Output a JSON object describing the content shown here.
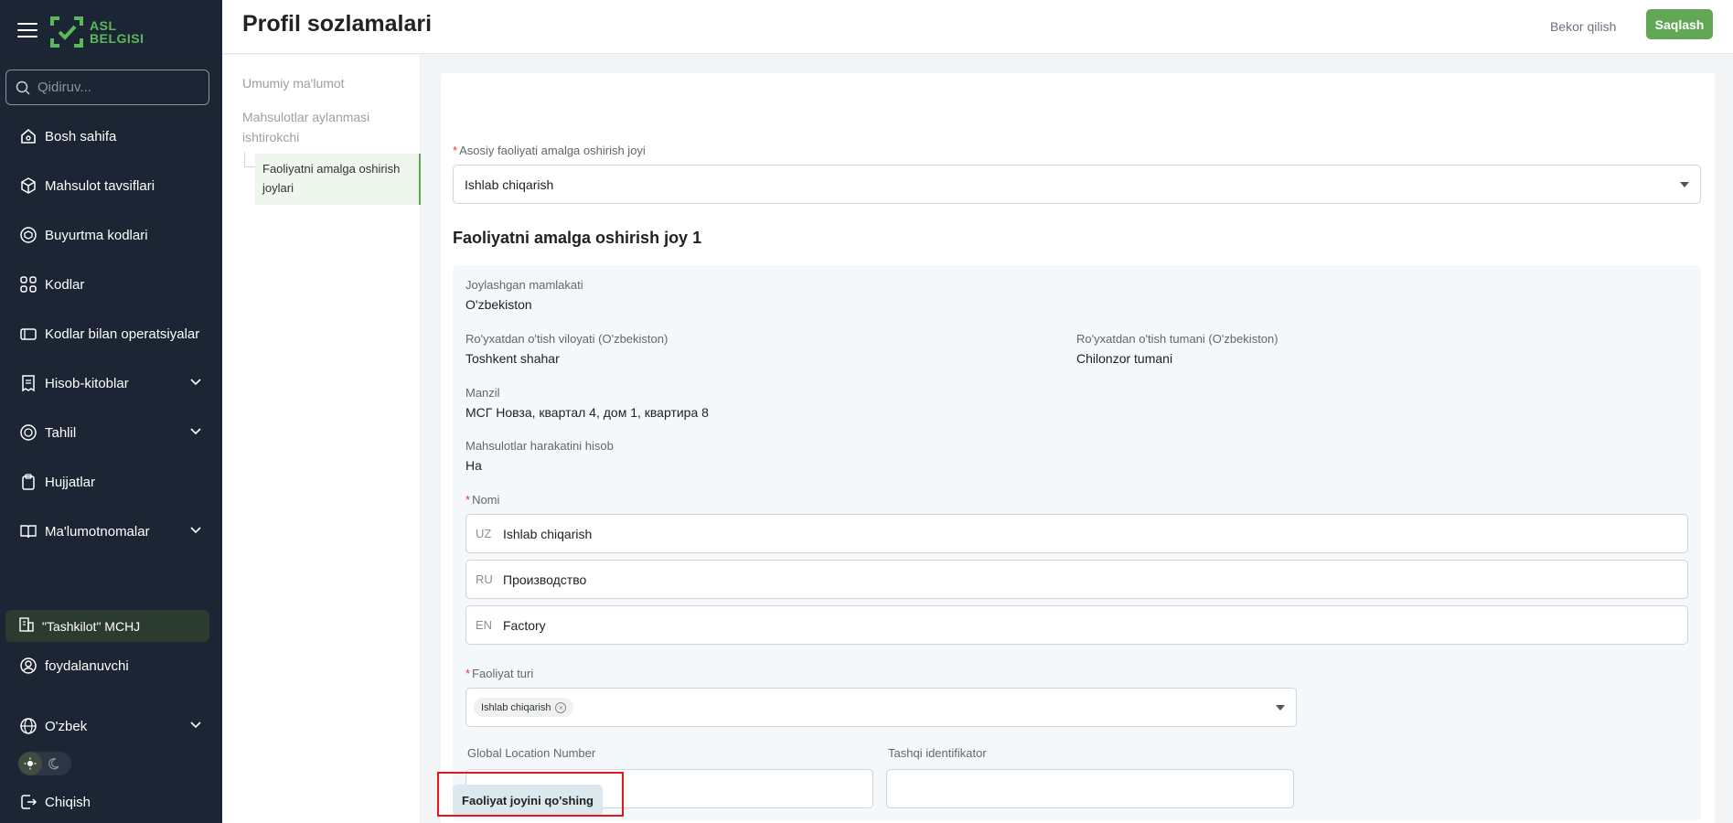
{
  "sidebar": {
    "logo_text_line1": "ASL",
    "logo_text_line2": "BELGISI",
    "search_placeholder": "Qidiruv...",
    "items": [
      {
        "label": "Bosh sahifa",
        "icon": "home-icon"
      },
      {
        "label": "Mahsulot tavsiflari",
        "icon": "box-icon"
      },
      {
        "label": "Buyurtma kodlari",
        "icon": "package-icon"
      },
      {
        "label": "Kodlar",
        "icon": "qr-icon"
      },
      {
        "label": "Kodlar bilan operatsiyalar",
        "icon": "tag-icon"
      },
      {
        "label": "Hisob-kitoblar",
        "icon": "receipt-icon"
      },
      {
        "label": "Tahlil",
        "icon": "chart-icon"
      },
      {
        "label": "Hujjatlar",
        "icon": "clipboard-icon"
      },
      {
        "label": "Ma'lumotnomalar",
        "icon": "book-icon"
      }
    ],
    "organization": "\"Tashkilot\" MCHJ",
    "user": "foydalanuvchi",
    "language": "O'zbek",
    "logout": "Chiqish"
  },
  "header": {
    "title": "Profil sozlamalari",
    "cancel_label": "Bekor qilish",
    "save_label": "Saqlash"
  },
  "subnav": {
    "items": [
      "Umumiy ma'lumot",
      "Mahsulotlar aylanmasi ishtirokchi",
      "Faoliyatni amalga oshirish joylari"
    ]
  },
  "form": {
    "main_place_label": "Asosiy faoliyati amalga oshirish joyi",
    "main_place_value": "Ishlab chiqarish",
    "section_title": "Faoliyatni amalga oshirish joy 1",
    "country_label": "Joylashgan mamlakati",
    "country_value": "O'zbekiston",
    "region_label": "Ro'yxatdan o'tish viloyati (O'zbekiston)",
    "region_value": "Toshkent shahar",
    "district_label": "Ro'yxatdan o'tish tumani (O'zbekiston)",
    "district_value": "Chilonzor tumani",
    "address_label": "Manzil",
    "address_value": "МСГ Новза, квартал 4, дом 1, квартира 8",
    "tracking_label": "Mahsulotlar harakatini hisob",
    "tracking_value": "На",
    "name_label": "Nomi",
    "names": [
      {
        "lang": "UZ",
        "value": "Ishlab chiqarish"
      },
      {
        "lang": "RU",
        "value": "Производство"
      },
      {
        "lang": "EN",
        "value": "Factory"
      }
    ],
    "activity_type_label": "Faoliyat turi",
    "activity_type_tag": "Ishlab chiqarish",
    "gln_label": "Global Location Number",
    "gln_value": "",
    "external_id_label": "Tashqi identifikator",
    "external_id_value": "",
    "add_button_label": "Faoliyat joyini qo'shing"
  },
  "colors": {
    "sidebar_bg": "#1b2533",
    "accent_green": "#62a756",
    "highlight_red": "#e0191e"
  }
}
